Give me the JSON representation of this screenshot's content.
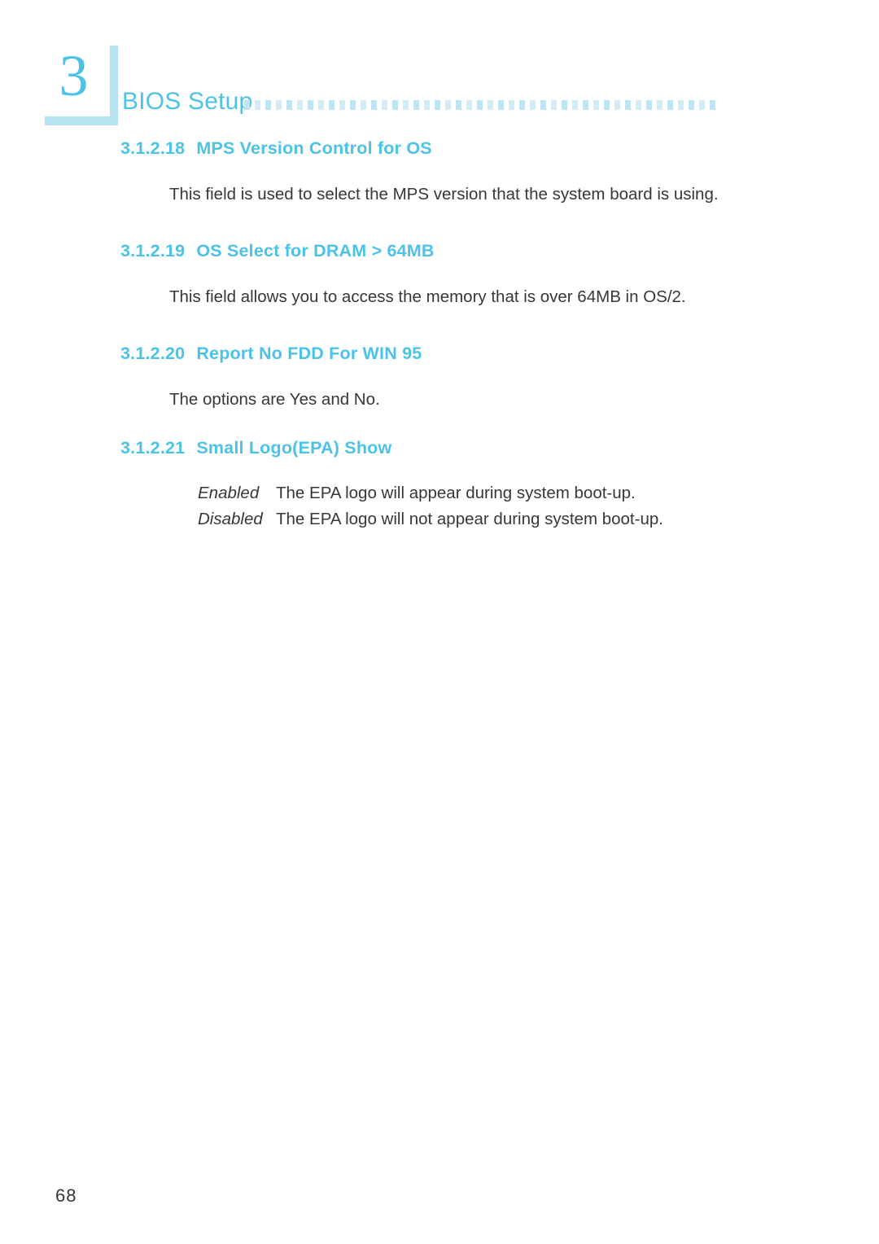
{
  "header": {
    "chapter_number": "3",
    "title": "BIOS Setup",
    "dot_count": 45,
    "accent_color": "#4cc3e6",
    "dot_color": "#bfe5f5"
  },
  "sections": [
    {
      "number": "3.1.2.18",
      "title": "MPS Version Control for OS",
      "body": "This field is used to select the MPS version that the system board is using."
    },
    {
      "number": "3.1.2.19",
      "title": "OS Select for DRAM > 64MB",
      "body": "This field allows you to access the memory that is over 64MB in OS/2."
    },
    {
      "number": "3.1.2.20",
      "title": "Report No FDD For WIN 95",
      "body": "The options are Yes and No."
    },
    {
      "number": "3.1.2.21",
      "title": "Small Logo(EPA) Show",
      "options": [
        {
          "term": "Enabled",
          "description": "The EPA logo will appear during system boot-up."
        },
        {
          "term": "Disabled",
          "description": "The EPA logo will not appear during system boot-up."
        }
      ]
    }
  ],
  "footer": {
    "page_number": "68"
  },
  "colors": {
    "heading": "#4cc3e6",
    "body_text": "#3b3539",
    "dot_light": "#d3ecf8",
    "shadow_box": "#b8e3f2",
    "background": "#ffffff"
  }
}
